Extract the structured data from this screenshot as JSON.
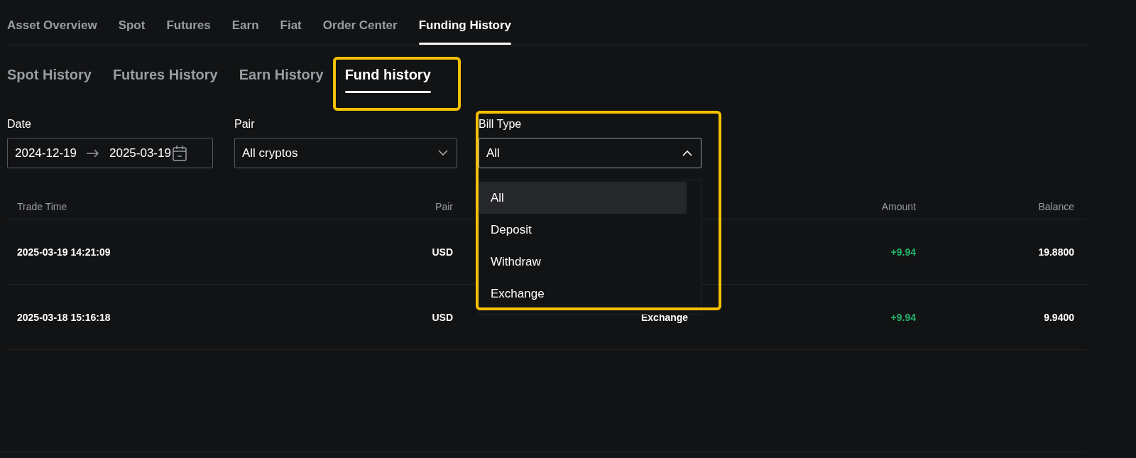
{
  "main_tabs": [
    {
      "label": "Asset Overview",
      "selected": false
    },
    {
      "label": "Spot",
      "selected": false
    },
    {
      "label": "Futures",
      "selected": false
    },
    {
      "label": "Earn",
      "selected": false
    },
    {
      "label": "Fiat",
      "selected": false
    },
    {
      "label": "Order Center",
      "selected": false
    },
    {
      "label": "Funding History",
      "selected": true
    }
  ],
  "sub_tabs": [
    {
      "label": "Spot History",
      "selected": false,
      "highlighted": false
    },
    {
      "label": "Futures History",
      "selected": false,
      "highlighted": false
    },
    {
      "label": "Earn History",
      "selected": false,
      "highlighted": false
    },
    {
      "label": "Fund history",
      "selected": true,
      "highlighted": true
    }
  ],
  "filters": {
    "date": {
      "label": "Date",
      "start": "2024-12-19",
      "end": "2025-03-19"
    },
    "pair": {
      "label": "Pair",
      "value": "All cryptos",
      "expanded": false
    },
    "bill_type": {
      "label": "Bill Type",
      "value": "All",
      "expanded": true,
      "highlighted": true,
      "options": [
        {
          "label": "All",
          "selected": true
        },
        {
          "label": "Deposit",
          "selected": false
        },
        {
          "label": "Withdraw",
          "selected": false
        },
        {
          "label": "Exchange",
          "selected": false
        }
      ]
    }
  },
  "table": {
    "columns": [
      "Trade Time",
      "Pair",
      "Amount",
      "Balance"
    ],
    "rows": [
      {
        "trade_time": "2025-03-19 14:21:09",
        "pair": "USD",
        "amount": "+9.94",
        "balance": "19.8800"
      },
      {
        "trade_time": "2025-03-18 15:16:18",
        "pair": "USD",
        "bill_type": "Exchange",
        "amount": "+9.94",
        "balance": "9.9400"
      }
    ]
  }
}
